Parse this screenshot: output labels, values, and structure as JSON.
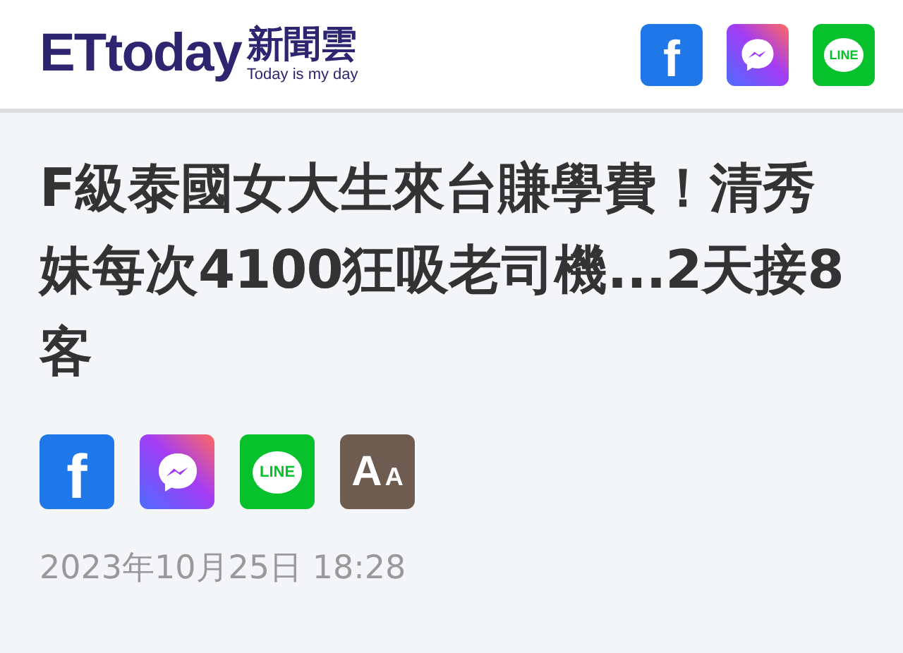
{
  "header": {
    "logo_text": "ETtoday",
    "logo_cjk": "新聞雲",
    "tagline": "Today is my day",
    "share_icons": [
      {
        "kind": "facebook",
        "label": "f"
      },
      {
        "kind": "messenger"
      },
      {
        "kind": "line",
        "label": "LINE"
      }
    ]
  },
  "article": {
    "headline": "F級泰國女大生來台賺學費！清秀妹每次4100狂吸老司機...2天接8客",
    "share_icons": [
      {
        "kind": "facebook",
        "label": "f"
      },
      {
        "kind": "messenger"
      },
      {
        "kind": "line",
        "label": "LINE"
      },
      {
        "kind": "font-size",
        "label": "A",
        "label_small": "A"
      }
    ],
    "date": "2023年10月25日 18:28"
  }
}
